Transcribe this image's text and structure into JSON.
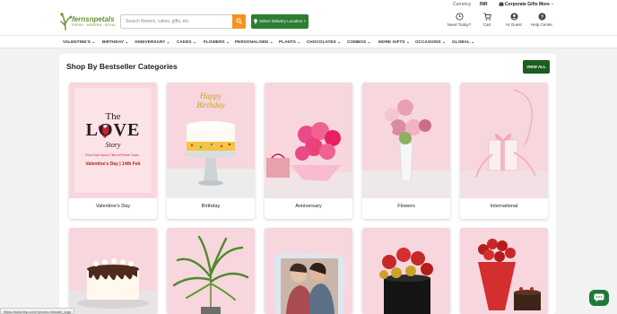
{
  "colors": {
    "brand_green": "#1b5e20",
    "accent_orange": "#f5931f",
    "card_pink": "#f8d6dd",
    "page_bg": "#f2f2f2"
  },
  "utility_bar": {
    "currency": "Currency",
    "inr": "INR",
    "corporate": "Corporate Gifts",
    "more": "More"
  },
  "header": {
    "logo_text": "fernsnpetals",
    "logo_tagline": "FRESH · MODERN · ROYAL",
    "search_placeholder": "Search flowers, cakes, gifts, etc.",
    "delivery_label": "Select Delivery Location >",
    "icons": [
      {
        "icon": "clock-icon",
        "label": "Need Today?"
      },
      {
        "icon": "cart-icon",
        "label": "Cart"
      },
      {
        "icon": "user-icon",
        "label": "Hi Guest"
      },
      {
        "icon": "help-icon",
        "label": "Help Center"
      }
    ]
  },
  "nav": {
    "items": [
      "VALENTINE'S ⌄",
      "BIRTHDAY ⌄",
      "ANNIVERSARY ⌄",
      "CAKES ⌄",
      "FLOWERS ⌄",
      "PERSONALISED ⌄",
      "PLANTS ⌄",
      "CHOCOLATES ⌄",
      "COMBOS ⌄",
      "MORE GIFTS ⌄",
      "OCCASIONS ⌄",
      "GLOBAL ⌄"
    ]
  },
  "section": {
    "title": "Shop By Bestseller Categories",
    "view_all": "VIEW ALL"
  },
  "valentine_art": {
    "the": "The",
    "love": "LOVE",
    "story": "Story",
    "sub": "From Once Upon a Time to Forever Yours...",
    "date": "Valentine's Day | 14th Feb"
  },
  "birthday_topper": {
    "line1": "Happy",
    "line2": "Birthday"
  },
  "categories": [
    {
      "label": "Valentine's Day",
      "image": "valentines-day-poster"
    },
    {
      "label": "Birthday",
      "image": "birthday-cake-image"
    },
    {
      "label": "Anniversary",
      "image": "pink-roses-gift-image"
    },
    {
      "label": "Flowers",
      "image": "rose-vase-image"
    },
    {
      "label": "International",
      "image": "gift-box-image"
    }
  ],
  "row2": [
    {
      "image": "drip-cake-image"
    },
    {
      "image": "potted-palm-image"
    },
    {
      "image": "couple-photo-cushion-image"
    },
    {
      "image": "rose-ferrero-box-image"
    },
    {
      "image": "rose-bouquet-cake-image"
    }
  ],
  "status_url": "https://www.fnp.com/?promo=header_logo"
}
